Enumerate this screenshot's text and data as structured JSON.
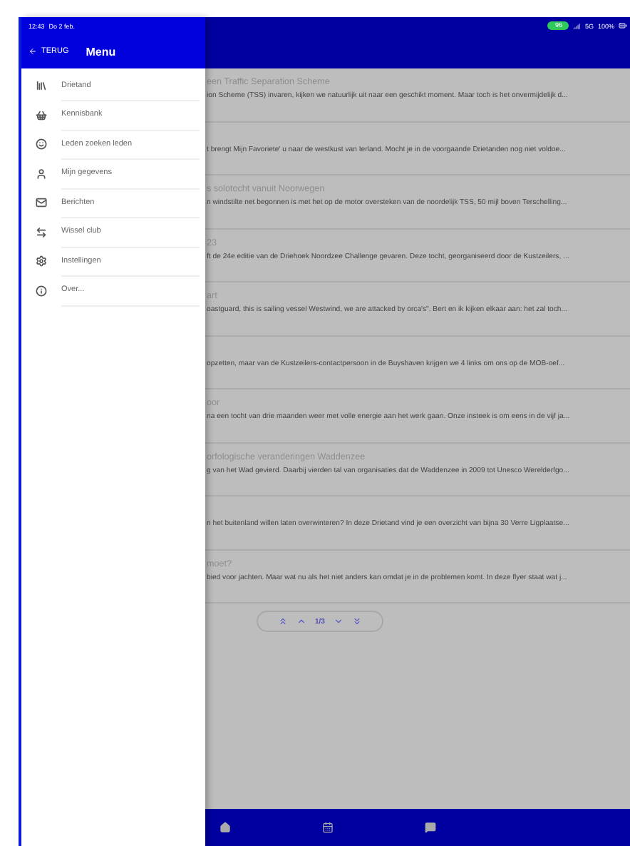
{
  "status_bar": {
    "time": "12:43",
    "date": "Do 2 feb.",
    "pill": "96",
    "network": "5G",
    "battery": "100%"
  },
  "drawer": {
    "back": "TERUG",
    "title": "Menu",
    "items": [
      {
        "label": "Drietand"
      },
      {
        "label": "Kennisbank"
      },
      {
        "label": "Leden zoeken leden"
      },
      {
        "label": "Mijn gegevens"
      },
      {
        "label": "Berichten"
      },
      {
        "label": "Wissel club"
      },
      {
        "label": "Instellingen"
      },
      {
        "label": "Over..."
      }
    ]
  },
  "articles": [
    {
      "title": "een Traffic Separation Scheme",
      "snippet": "ion Scheme (TSS) invaren, kijken we natuurlijk uit naar een geschikt moment. Maar toch is het onvermijdelijk d..."
    },
    {
      "snippet": "t brengt  Mijn Favoriete' u naar de westkust van Ierland. Mocht je in de voorgaande Drietanden nog niet voldoe..."
    },
    {
      "title": "s solotocht vanuit Noorwegen",
      "snippet": "n windstilte net begonnen is met het op de motor oversteken van de noordelijk TSS, 50 mijl boven Terschelling..."
    },
    {
      "title": "23",
      "snippet": "ft de 24e editie van de Driehoek Noordzee Challenge gevaren. Deze tocht, georganiseerd door de Kustzeilers, ..."
    },
    {
      "title": "art",
      "snippet": "oastguard, this is sailing vessel Westwind, we are attacked by orca's\". Bert en ik kijken elkaar aan: het zal toch..."
    },
    {
      "snippet": "opzetten, maar van de Kustzeilers-contactpersoon in de Buyshaven krijgen we 4 links om ons op de MOB-oef..."
    },
    {
      "title": "oor",
      "snippet": "na een tocht van drie maanden weer met volle energie aan het werk gaan. Onze insteek is om eens in de vijf ja..."
    },
    {
      "title": "orfologische veranderingen Waddenzee",
      "snippet": "g van het Wad gevierd. Daarbij vierden tal van organisaties dat de Waddenzee in 2009 tot Unesco Werelderfgo..."
    },
    {
      "snippet": "n het buitenland willen laten overwinteren? In deze Drietand vind je een overzicht van bijna 30 Verre Ligplaatse..."
    },
    {
      "title": "moet?",
      "snippet": "bied voor jachten. Maar wat nu als het niet anders kan omdat je in de problemen komt. In deze flyer staat wat j..."
    }
  ],
  "pager": {
    "page": "1/3"
  }
}
